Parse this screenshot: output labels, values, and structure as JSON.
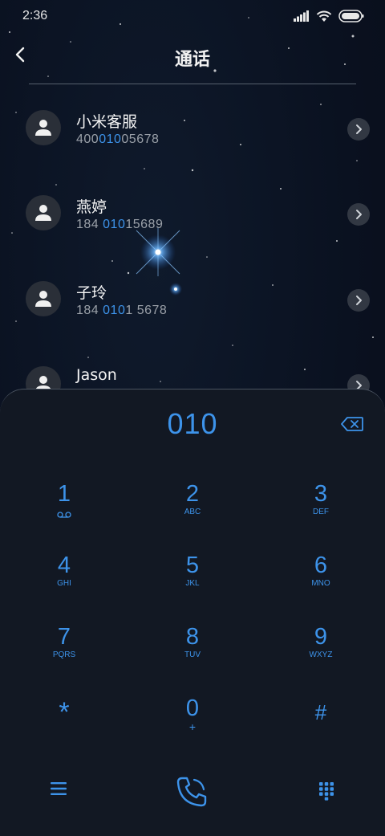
{
  "status": {
    "time": "2:36"
  },
  "header": {
    "title": "通话",
    "back_icon": "chevron-left-icon"
  },
  "contacts": [
    {
      "name": "小米客服",
      "num_pre": "400",
      "num_hl": "010",
      "num_post": "05678"
    },
    {
      "name": "燕婷",
      "num_pre": "184 ",
      "num_hl": "010",
      "num_post": "15689"
    },
    {
      "name": "子玲",
      "num_pre": "184 ",
      "num_hl": "010",
      "num_post": "1 5678"
    },
    {
      "name": "Jason",
      "num_pre": "",
      "num_hl": "",
      "num_post": ""
    }
  ],
  "dialer": {
    "number": "010",
    "keys": [
      {
        "digit": "1",
        "letters": ""
      },
      {
        "digit": "2",
        "letters": "ABC"
      },
      {
        "digit": "3",
        "letters": "DEF"
      },
      {
        "digit": "4",
        "letters": "GHI"
      },
      {
        "digit": "5",
        "letters": "JKL"
      },
      {
        "digit": "6",
        "letters": "MNO"
      },
      {
        "digit": "7",
        "letters": "PQRS"
      },
      {
        "digit": "8",
        "letters": "TUV"
      },
      {
        "digit": "9",
        "letters": "WXYZ"
      },
      {
        "digit": "*",
        "letters": ""
      },
      {
        "digit": "0",
        "letters": "+"
      },
      {
        "digit": "#",
        "letters": ""
      }
    ]
  },
  "colors": {
    "accent": "#3d93ea",
    "background": "#0a1120",
    "panel": "#121823"
  }
}
